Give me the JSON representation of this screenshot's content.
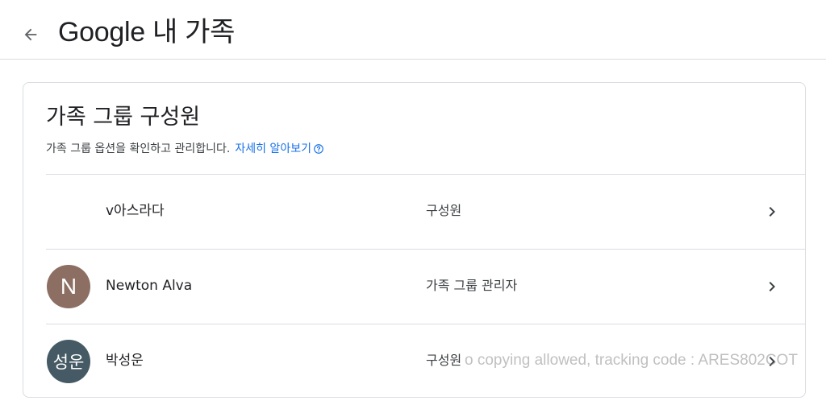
{
  "header": {
    "title": "Google 내 가족",
    "back_icon": "arrow-back-icon"
  },
  "card": {
    "title": "가족 그룹 구성원",
    "description": "가족 그룹 옵션을 확인하고 관리합니다.",
    "learn_more_label": "자세히 알아보기",
    "help_icon": "help-circle-icon"
  },
  "members": [
    {
      "avatar_text": "",
      "avatar_color": "",
      "name": "v아스라다",
      "role": "구성원",
      "chevron_icon": "chevron-right-icon"
    },
    {
      "avatar_text": "N",
      "avatar_color": "#8d6e63",
      "name": "Newton Alva",
      "role": "가족 그룹 관리자",
      "chevron_icon": "chevron-right-icon"
    },
    {
      "avatar_text": "성운",
      "avatar_color": "#455a64",
      "name": "박성운",
      "role": "구성원",
      "chevron_icon": "chevron-right-icon"
    }
  ],
  "watermark": "o copying allowed, tracking code : ARES802COT",
  "colors": {
    "link": "#1a73e8",
    "divider": "#dadce0"
  }
}
